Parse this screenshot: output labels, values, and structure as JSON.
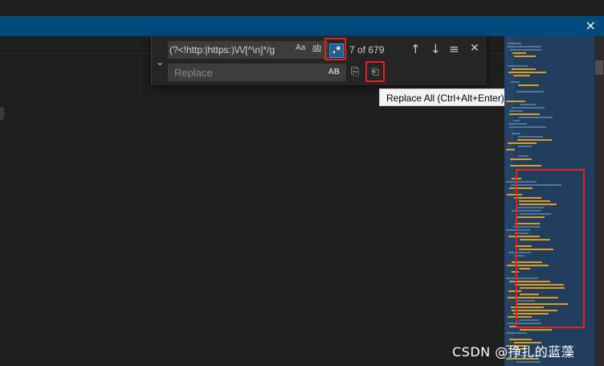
{
  "window": {
    "close_glyph": "×"
  },
  "find_widget": {
    "toggle_glyph": "⌄",
    "find_value": "(?<!http:|https:)\\/\\/[^\\n]*/g",
    "match_case_label": "Aa",
    "whole_word_label": "ab",
    "regex_label": ".*",
    "match_count": "7 of 679",
    "prev_glyph": "↑",
    "next_glyph": "↓",
    "selection_glyph": "≡",
    "close_glyph": "✕",
    "replace_placeholder": "Replace",
    "preserve_case_label": "AB",
    "replace_one_glyph": "⎘",
    "replace_all_glyph": "⎗"
  },
  "tooltip": {
    "text": "Replace All (Ctrl+Alt+Enter)"
  },
  "watermark": {
    "text": "CSDN @挣扎的蓝藻"
  },
  "colors": {
    "editor_bg": "#1e1e1e",
    "notification_bar": "#004a7c",
    "annotation_red": "#e8211f",
    "minimap_match": "#e8a01c"
  }
}
